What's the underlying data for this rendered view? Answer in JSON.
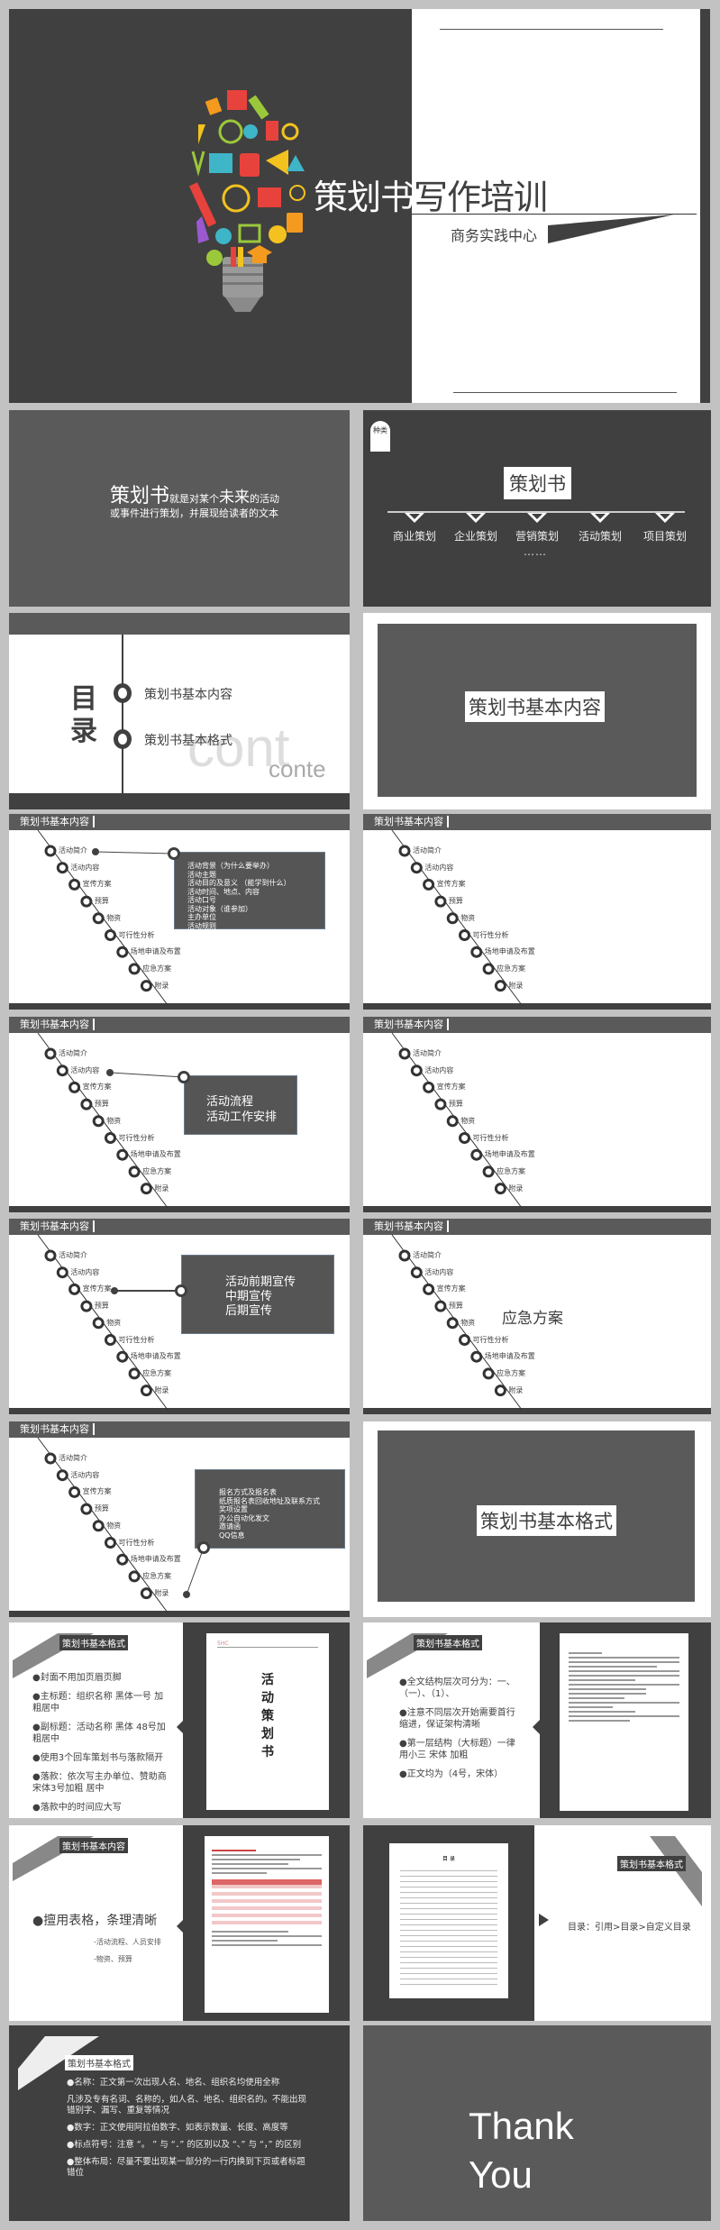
{
  "cover": {
    "title_left": "策划书",
    "title_right": "写作培训",
    "subtitle": "商务实践中心",
    "illustration": "lightbulb-icon-collage"
  },
  "definition": {
    "term": "策划书",
    "text1": "就是对某个",
    "emph": "未来",
    "text2": "的活动",
    "line2": "或事件进行策划，并展现给读者的文本"
  },
  "types": {
    "tag": "种类",
    "title": "策划书",
    "categories": [
      "商业策划",
      "企业策划",
      "营销策划",
      "活动策划",
      "项目策划"
    ],
    "ellipsis": "……"
  },
  "toc": {
    "heading": "目录",
    "heading_chars": [
      "目",
      "录"
    ],
    "items": [
      "策划书基本内容",
      "策划书基本格式"
    ],
    "ghost_large": "cont",
    "ghost_small": "conte"
  },
  "section1": {
    "label": "策划书基本内容"
  },
  "section2": {
    "label": "策划书基本格式"
  },
  "timeline": {
    "header": "策划书基本内容",
    "nodes": [
      "活动简介",
      "活动内容",
      "宣传方案",
      "预算",
      "物资",
      "可行性分析",
      "场地申请及布置",
      "应急方案",
      "附录"
    ]
  },
  "details": {
    "intro": "活动背景（为什么要举办）\n活动主题\n活动目的及意义 （能学到什么）\n活动时间、地点、内容\n活动口号\n活动对象（谁参加）\n主办单位\n活动规则",
    "content": "活动流程\n活动工作安排",
    "promo": "活动前期宣传\n中期宣传\n后期宣传",
    "emergency": "应急方案",
    "appendix": "报名方式及报名表\n纸质报名表回收地址及联系方式\n奖项设置\n办公自动化发文\n邀请函\nQQ信息"
  },
  "format1": {
    "ribbon": "策划书基本格式",
    "bullets": [
      "●封面不用加页眉页脚",
      "●主标题：组织名称 黑体一号 加粗居中",
      "●副标题：活动名称 黑体 48号加粗居中",
      "●使用3个回车策划书与落款隔开",
      "●落款：依次写主办单位、赞助商 宋体3号加粗 居中",
      "●落款中的时间应大写"
    ],
    "doc_title_chars": [
      "活",
      "动",
      "策",
      "划",
      "书"
    ]
  },
  "format2": {
    "ribbon": "策划书基本格式",
    "bullets": [
      "●全文结构层次可分为：一、（一）、（1）、",
      "●注意不同层次开始需要首行缩进，保证架构清晰",
      "●第一层结构（大标题）一律用小三 宋体 加粗",
      "●正文均为（4号，宋体）"
    ]
  },
  "format3": {
    "ribbon": "策划书基本内容",
    "main": "●擅用表格，条理清晰",
    "subs": [
      "-活动流程、人员安排",
      "-物资、预算"
    ]
  },
  "format4": {
    "ribbon": "策划书基本格式",
    "note": "目录：引用>目录>自定义目录",
    "doc_heading": "目 录"
  },
  "format5": {
    "ribbon": "策划书基本格式",
    "bullets": [
      "●名称：正文第一次出现人名、地名、组织名均使用全称",
      "凡涉及专有名词、名称的，如人名、地名、组织名的。不能出现错别字、漏写、重复等情况",
      "●数字：正文使用阿拉伯数字、如表示数量、长度、高度等",
      "●标点符号：注意 “。 ” 与 “．” 的区别以及 “、” 与 “，” 的区别",
      "●整体布局：尽量不要出现某一部分的一行内换到下页或者标题错位"
    ]
  },
  "closing": {
    "text": "Thank\nYou"
  },
  "colors": {
    "dark": "#404040",
    "mid": "#5a5a5a",
    "bg": "#c2c2c2",
    "white": "#ffffff"
  }
}
